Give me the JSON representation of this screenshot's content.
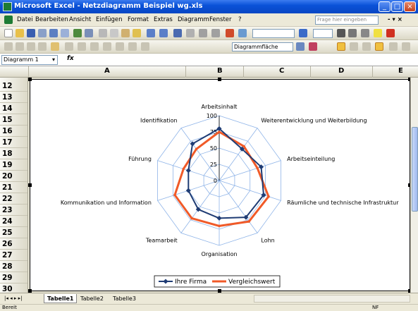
{
  "window": {
    "title": "Microsoft Excel - Netzdiagramm Beispiel wg.xls",
    "min": "_",
    "max": "□",
    "close": "×"
  },
  "menubar": {
    "items": [
      "Datei",
      "Bearbeiten",
      "Ansicht",
      "Einfügen",
      "Format",
      "Extras",
      "Diagramm",
      "Fenster",
      "?"
    ],
    "help_placeholder": "Frage hier eingeben",
    "doc_controls": "- ▾ ×"
  },
  "charttoolbar": {
    "element_selector": "Diagrammfläche"
  },
  "formulabar": {
    "namebox": "Diagramm 1",
    "namebox_arrow": "▾",
    "fx": "fx"
  },
  "columns": [
    "A",
    "B",
    "C",
    "D",
    "E"
  ],
  "rows": [
    "12",
    "13",
    "14",
    "15",
    "16",
    "17",
    "18",
    "19",
    "20",
    "21",
    "22",
    "23",
    "24",
    "25",
    "26",
    "27",
    "28",
    "29",
    "30"
  ],
  "sheets": {
    "nav": "|◂ ◂ ▸ ▸|",
    "tabs": [
      "Tabelle1",
      "Tabelle2",
      "Tabelle3"
    ]
  },
  "statusbar": {
    "left": "Bereit",
    "right": "NF"
  },
  "colors": {
    "series1": "#1f3c74",
    "series2": "#f05a28",
    "grid": "#8fb4e8"
  },
  "chart_data": {
    "type": "radar",
    "categories": [
      "Arbeitsinhalt",
      "Weiterentwicklung und Weiterbildung",
      "Arbeitseinteilung",
      "Räumliche und technische Infrastruktur",
      "Lohn",
      "Organisation",
      "Teamarbeit",
      "Kommunikation und Information",
      "Führung",
      "Identifikation"
    ],
    "ticks": [
      "0",
      "25",
      "50",
      "75",
      "100"
    ],
    "rmax": 100,
    "series": [
      {
        "name": "Ihre Firma",
        "values": [
          80,
          60,
          68,
          72,
          70,
          58,
          55,
          50,
          50,
          70
        ]
      },
      {
        "name": "Vergleichswert",
        "values": [
          75,
          65,
          62,
          80,
          78,
          70,
          72,
          72,
          58,
          60
        ]
      }
    ],
    "legend_position": "bottom",
    "grid": true
  }
}
